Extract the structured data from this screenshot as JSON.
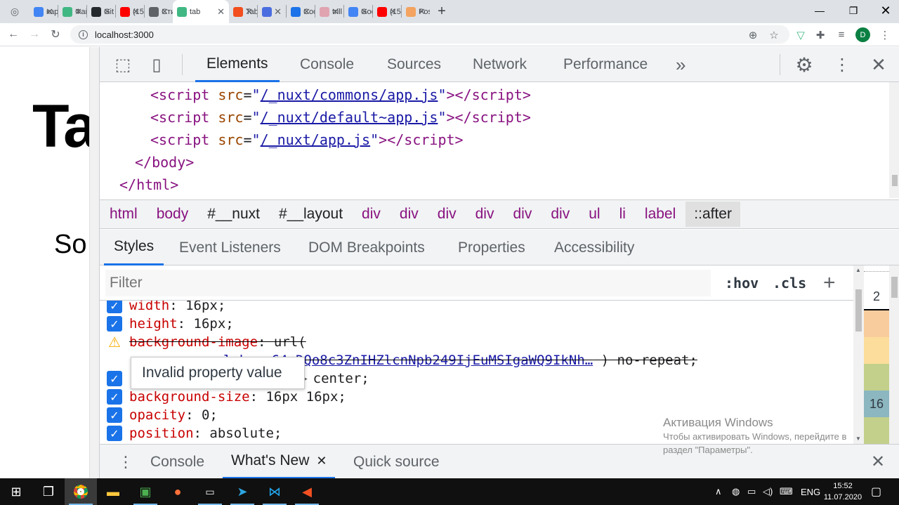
{
  "browser": {
    "tabs": [
      {
        "label": "кар",
        "color": "#4285f4"
      },
      {
        "label": "Фай",
        "color": "#41b883"
      },
      {
        "label": "Git",
        "color": "#24292e"
      },
      {
        "label": "(152",
        "color": "#ff0000"
      },
      {
        "label": "Сти",
        "color": "#5f6368"
      },
      {
        "label": "tab",
        "color": "#41b883"
      },
      {
        "label": "Tab",
        "color": "#f24e1e"
      },
      {
        "label": "",
        "color": "#4a6ee0"
      },
      {
        "label": "Coo",
        "color": "#1a73e8"
      },
      {
        "label": "trill",
        "color": "#e0a3b0"
      },
      {
        "label": "Goo",
        "color": "#4285f4"
      },
      {
        "label": "(15:",
        "color": "#ff0000"
      },
      {
        "label": "Pos",
        "color": "#f4a460"
      }
    ],
    "active_tab_index": 5,
    "url": "localhost:3000",
    "profile_initial": "D"
  },
  "page": {
    "title": "Ta",
    "subtitle": "So"
  },
  "devtools": {
    "main_tabs": [
      "Elements",
      "Console",
      "Sources",
      "Network",
      "Performance"
    ],
    "more_tabs_glyph": "»",
    "code_lines": [
      {
        "tag": "script",
        "attr": "src",
        "value": "/_nuxt/commons/app.js",
        "indent": 2
      },
      {
        "tag": "script",
        "attr": "src",
        "value": "/_nuxt/default~app.js",
        "indent": 2
      },
      {
        "tag": "script",
        "attr": "src",
        "value": "/_nuxt/app.js",
        "indent": 2
      }
    ],
    "close_body": "</body>",
    "close_html": "</html>",
    "breadcrumbs": [
      {
        "label": "html",
        "kind": "plain"
      },
      {
        "label": "body",
        "kind": "plain"
      },
      {
        "label": "#__nuxt",
        "kind": "id"
      },
      {
        "label": "#__layout",
        "kind": "id"
      },
      {
        "label": "div",
        "kind": "plain"
      },
      {
        "label": "div",
        "kind": "plain"
      },
      {
        "label": "div",
        "kind": "plain"
      },
      {
        "label": "div",
        "kind": "plain"
      },
      {
        "label": "div",
        "kind": "plain"
      },
      {
        "label": "div",
        "kind": "plain"
      },
      {
        "label": "ul",
        "kind": "plain"
      },
      {
        "label": "li",
        "kind": "plain"
      },
      {
        "label": "label",
        "kind": "plain"
      },
      {
        "label": "::after",
        "kind": "active"
      }
    ],
    "sub_tabs": [
      "Styles",
      "Event Listeners",
      "DOM Breakpoints",
      "Properties",
      "Accessibility"
    ],
    "filter_placeholder": "Filter",
    "hov_label": ":hov",
    "cls_label": ".cls",
    "props": {
      "width_name": "width",
      "width_value": "16px",
      "height_name": "height",
      "height_value": "16px",
      "bgimage_name": "background-image",
      "bgimage_value": "url(",
      "bgimage_data": "data:image/svg+xml;base64,DQo8c3ZnIHZlcnNpb249IjEuMSIgaWQ9IkNh…",
      "bgimage_hidden_prefix": "data:image/svg+xml",
      "bgimage_visible_link": "l;base64,DQo8c3ZnIHZlcnNpb249IjEuMSIgaWQ9IkNh…",
      "bgimage_tail": ") no-repeat;",
      "bgpos_value": "center;",
      "bgsize_name": "background-size",
      "bgsize_value": "16px 16px;",
      "opacity_name": "opacity",
      "opacity_value": "0;",
      "position_name": "position",
      "position_value": "absolute;"
    },
    "tooltip": "Invalid property value",
    "boxmodel": {
      "top": "2",
      "mid": "16"
    },
    "drawer_tabs": [
      "Console",
      "What's New",
      "Quick source"
    ]
  },
  "watermark": {
    "title": "Активация Windows",
    "text": "Чтобы активировать Windows, перейдите в раздел \"Параметры\"."
  },
  "taskbar": {
    "lang": "ENG",
    "time": "15:52",
    "date": "11.07.2020"
  }
}
